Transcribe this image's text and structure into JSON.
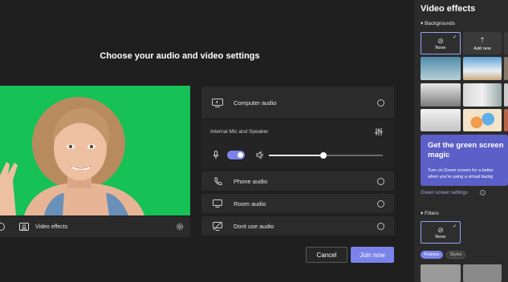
{
  "prejoin": {
    "title": "Choose your audio and video settings",
    "video_effects_label": "Video effects"
  },
  "audio": {
    "options": [
      {
        "label": "Computer audio",
        "icon": "computer-audio-icon"
      },
      {
        "label": "Phone audio",
        "icon": "phone-icon"
      },
      {
        "label": "Room audio",
        "icon": "monitor-icon"
      },
      {
        "label": "Dont use audio",
        "icon": "no-audio-icon"
      }
    ],
    "device_label": "Internal Mic and Speaker",
    "mic_enabled": true,
    "speaker_volume": 0.48
  },
  "buttons": {
    "cancel": "Cancel",
    "join": "Join now"
  },
  "effects_panel": {
    "title": "Video effects",
    "backgrounds_header": "Backgrounds",
    "none_label": "None",
    "add_new_label": "Add new",
    "promo_title": "Get the green screen magic",
    "promo_text_line1": "Turn on Green screen for a better",
    "promo_text_line2": "when you're using a virtual backg",
    "green_screen_link": "Green screen settings",
    "filters_header": "Filters",
    "filters_none_label": "None",
    "tabs": [
      "Frames",
      "Styles"
    ],
    "colors": {
      "accent": "#7b83eb",
      "promo": "#5b5fc7",
      "green_screen": "#16c156"
    }
  }
}
